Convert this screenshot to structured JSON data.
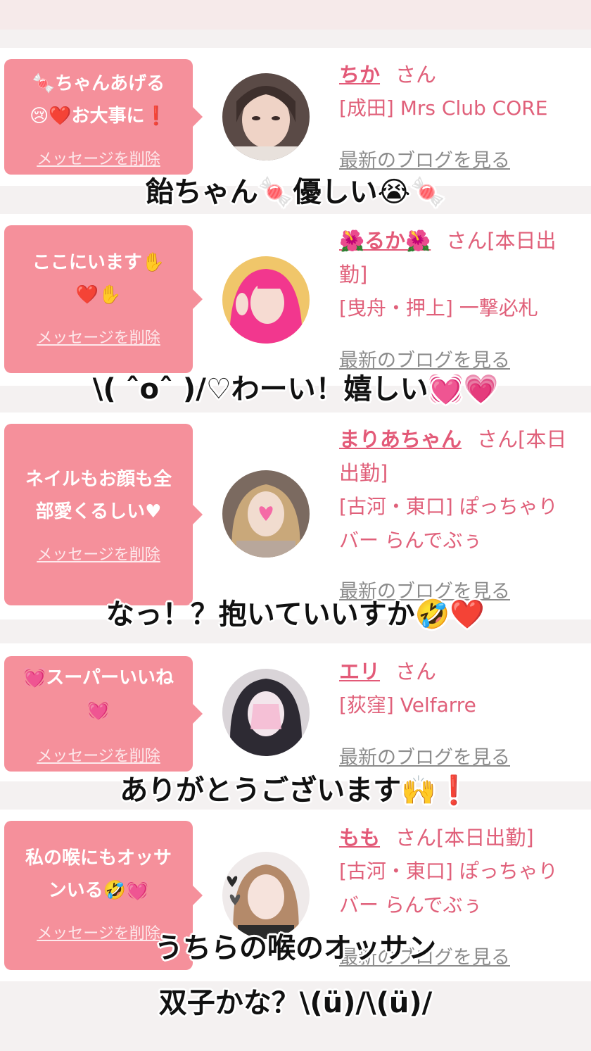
{
  "colors": {
    "accent": "#f5909b",
    "name": "#e35a78",
    "link_gray": "#8c8c8c"
  },
  "delete_label": "メッセージを削除",
  "blog_label": "最新のブログを見る",
  "entries": [
    {
      "message_lines": [
        "🍬ちゃんあげる",
        "😢❤️お大事に❗"
      ],
      "name": "ちか",
      "san": "さん",
      "shop_lines": [
        "[成田] Mrs Club CORE"
      ],
      "caption_lines": [
        "飴ちゃん🍬優しい😭🍬"
      ]
    },
    {
      "message_lines": [
        "ここにいます✋",
        "❤️✋"
      ],
      "name": "🌺るか🌺",
      "san": "さん[本日出",
      "name_line2": "勤]",
      "shop_lines": [
        "[曳舟・押上] 一撃必札"
      ],
      "caption_lines": [
        "\\( ˆoˆ )/♡わーい！嬉しい💓💗"
      ]
    },
    {
      "message_lines": [
        "ネイルもお顔も全",
        "部愛くるしい♥"
      ],
      "name": "まりあちゃん",
      "san": "さん[本日",
      "name_line2": "出勤]",
      "shop_lines": [
        "[古河・東口] ぽっちゃり",
        "バー らんでぶぅ"
      ],
      "caption_lines": [
        "なっ！？抱いていいすか🤣❤️"
      ]
    },
    {
      "message_lines": [
        "💓スーパーいいね",
        "💓"
      ],
      "name": "エリ",
      "san": "さん",
      "shop_lines": [
        "[荻窪] Velfarre"
      ],
      "caption_lines": [
        "ありがとうございます🙌❗"
      ]
    },
    {
      "message_lines": [
        "私の喉にもオッサ",
        "ンいる🤣💓"
      ],
      "name": "もも",
      "san": "さん[本日出勤]",
      "shop_lines": [
        "[古河・東口] ぽっちゃり",
        "バー らんでぶぅ"
      ],
      "caption_lines": [
        "うちらの喉のオッサン",
        "双子かな？\\(ü)/\\(ü)/"
      ]
    }
  ]
}
